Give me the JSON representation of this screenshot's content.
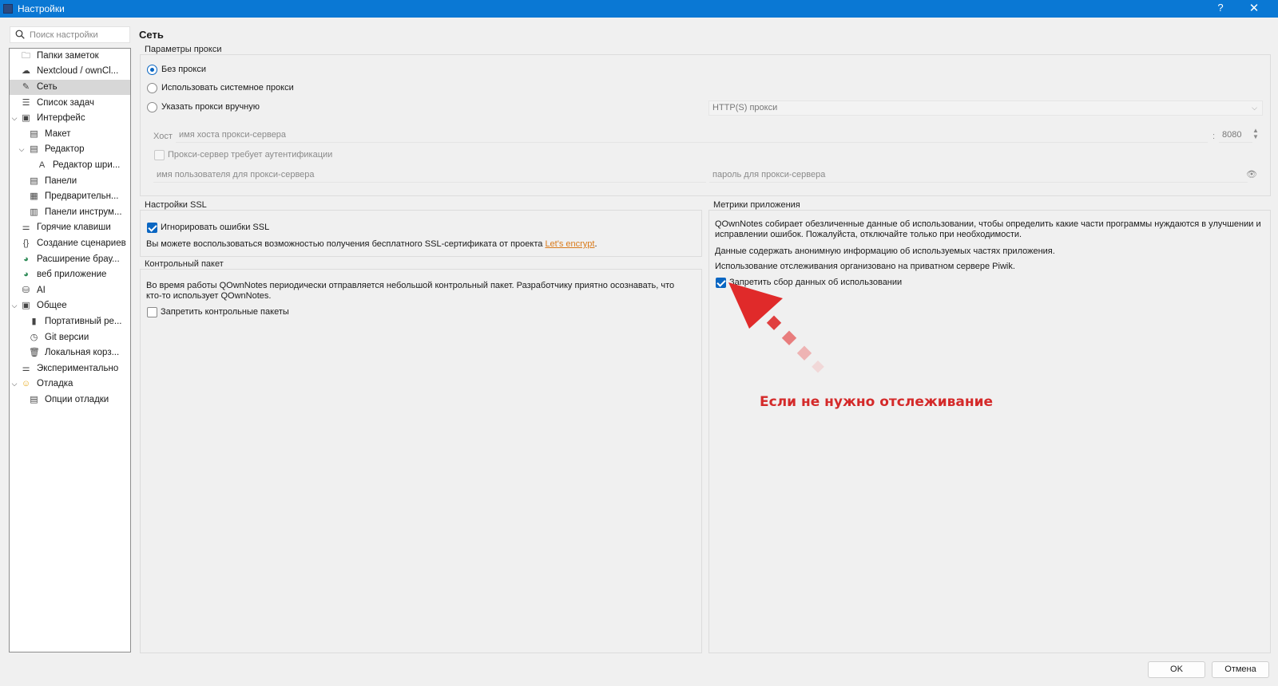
{
  "window": {
    "title": "Настройки",
    "help": "?",
    "close": "✕"
  },
  "search": {
    "placeholder": "Поиск настройки"
  },
  "sidebar": {
    "items": [
      {
        "label": "Папки заметок",
        "icon": "folder-icon"
      },
      {
        "label": "Nextcloud / ownCl...",
        "icon": "cloud-icon"
      },
      {
        "label": "Сеть",
        "icon": "network-icon"
      },
      {
        "label": "Список задач",
        "icon": "todo-list-icon"
      },
      {
        "label": "Интерфейс",
        "icon": "interface-icon"
      },
      {
        "label": "Макет",
        "icon": "layout-icon"
      },
      {
        "label": "Редактор",
        "icon": "editor-icon"
      },
      {
        "label": "Редактор шри...",
        "icon": "font-icon"
      },
      {
        "label": "Панели",
        "icon": "panels-icon"
      },
      {
        "label": "Предварительн...",
        "icon": "preview-icon"
      },
      {
        "label": "Панели инструм...",
        "icon": "toolbars-icon"
      },
      {
        "label": "Горячие клавиши",
        "icon": "shortcuts-icon"
      },
      {
        "label": "Создание сценариев",
        "icon": "scripting-icon"
      },
      {
        "label": "Расширение брау...",
        "icon": "browser-extension-icon"
      },
      {
        "label": "веб приложение",
        "icon": "web-app-icon"
      },
      {
        "label": "AI",
        "icon": "ai-icon"
      },
      {
        "label": "Общее",
        "icon": "general-icon"
      },
      {
        "label": "Портативный ре...",
        "icon": "portable-icon"
      },
      {
        "label": "Git версии",
        "icon": "git-icon"
      },
      {
        "label": "Локальная корз...",
        "icon": "trash-icon"
      },
      {
        "label": "Экспериментально",
        "icon": "experimental-icon"
      },
      {
        "label": "Отладка",
        "icon": "debug-icon"
      },
      {
        "label": "Опции отладки",
        "icon": "debug-options-icon"
      }
    ]
  },
  "page": {
    "title": "Сеть"
  },
  "proxy": {
    "title": "Параметры прокси",
    "no_proxy": "Без прокси",
    "system_proxy": "Использовать системное прокси",
    "manual_proxy": "Указать прокси вручную",
    "proxy_type": "HTTP(S) прокси",
    "host_label": "Хост",
    "host_placeholder": "имя хоста прокси-сервера",
    "port_separator": ":",
    "port_value": "8080",
    "auth_required": "Прокси-сервер требует аутентификации",
    "user_placeholder": "имя пользователя для прокси-сервера",
    "password_placeholder": "пароль для прокси-сервера"
  },
  "ssl": {
    "title": "Настройки SSL",
    "ignore_errors": "Игнорировать ошибки SSL",
    "info_prefix": "Вы можете воспользоваться возможностью получения бесплатного SSL-сертификата от проекта ",
    "link": "Let's encrypt",
    "info_suffix": "."
  },
  "heartbeat": {
    "title": "Контрольный пакет",
    "text": "Во время работы QOwnNotes периодически отправляется небольшой контрольный пакет. Разработчику приятно осознавать, что кто-то использует QOwnNotes.",
    "disable": "Запретить контрольные пакеты"
  },
  "metrics": {
    "title": "Метрики приложения",
    "text1": "QOwnNotes собирает обезличенные данные об использовании, чтобы определить какие части программы нуждаются в улучшении и исправлении ошибок. Пожалуйста, отключайте только при необходимости.",
    "text2": "Данные содержать анонимную информацию об используемых частях приложения.",
    "text3": "Использование отслеживания организовано на приватном сервере Piwik.",
    "disable": "Запретить сбор данных об использовании"
  },
  "annotation": {
    "text": "Если не нужно отслеживание",
    "color": "#d42a2a"
  },
  "footer": {
    "ok": "OK",
    "cancel": "Отмена"
  },
  "colors": {
    "accent": "#0a66c2",
    "titlebar": "#0a78d4",
    "link": "#d97a1a"
  }
}
